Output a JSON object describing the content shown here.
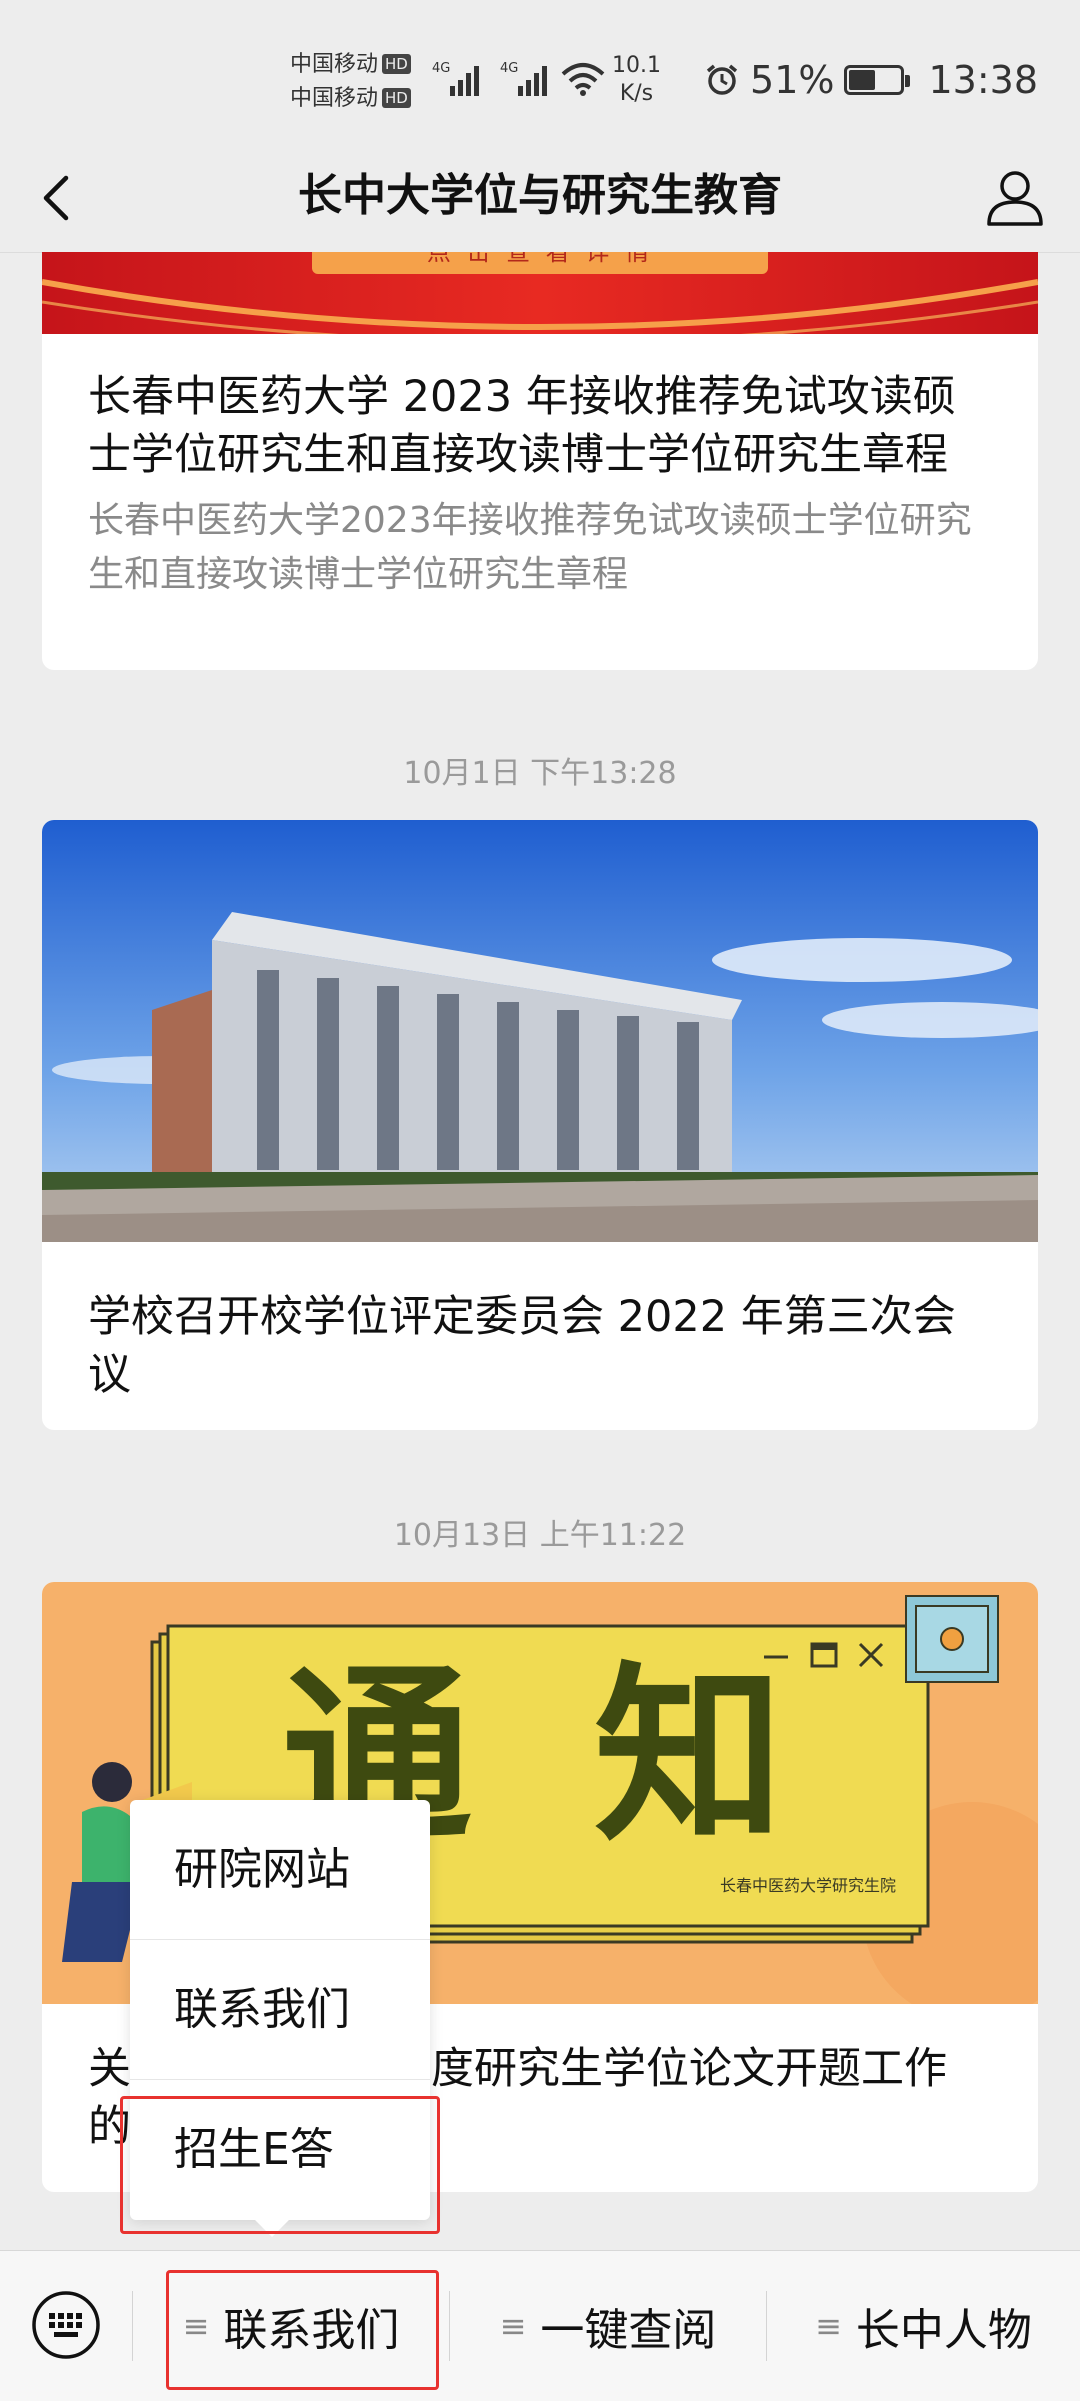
{
  "status_bar": {
    "carrier_1": "中国移动",
    "carrier_2": "中国移动",
    "hd_label": "HD",
    "net_type": "4G",
    "net_speed_value": "10.1",
    "net_speed_unit": "K/s",
    "battery_percent": "51%",
    "battery_level": 0.51,
    "time": "13:38"
  },
  "nav": {
    "title": "长中大学位与研究生教育",
    "back_icon": "chevron-left-icon",
    "profile_icon": "person-icon"
  },
  "feed": {
    "article_1": {
      "banner_text": "点 击 查 看 详 情",
      "title": "长春中医药大学 2023 年接收推荐免试攻读硕士学位研究生和直接攻读博士学位研究生章程",
      "description": "长春中医药大学2023年接收推荐免试攻读硕士学位研究生和直接攻读博士学位研究生章程"
    },
    "timestamp_2": "10月1日 下午13:28",
    "article_2": {
      "title": "学校召开校学位评定委员会 2022 年第三次会议"
    },
    "timestamp_3": "10月13日 上午11:22",
    "article_3": {
      "poster_headline_1": "通",
      "poster_headline_2": "知",
      "poster_caption": "长春中医药大学研究生院",
      "title_start": "关",
      "title_visible": "度研究生学位论文开题工作",
      "title_line2_start": "的"
    }
  },
  "popup_menu": {
    "items": [
      "研院网站",
      "联系我们",
      "招生E答"
    ]
  },
  "bottom_menu": {
    "keyboard_icon": "keyboard-icon",
    "items": [
      "联系我们",
      "一键查阅",
      "长中人物"
    ],
    "menu_glyph": "≡"
  },
  "colors": {
    "highlight": "#e8322f",
    "background": "#ededed",
    "poster_bg": "#f6b16a",
    "poster_card": "#f0db52"
  }
}
